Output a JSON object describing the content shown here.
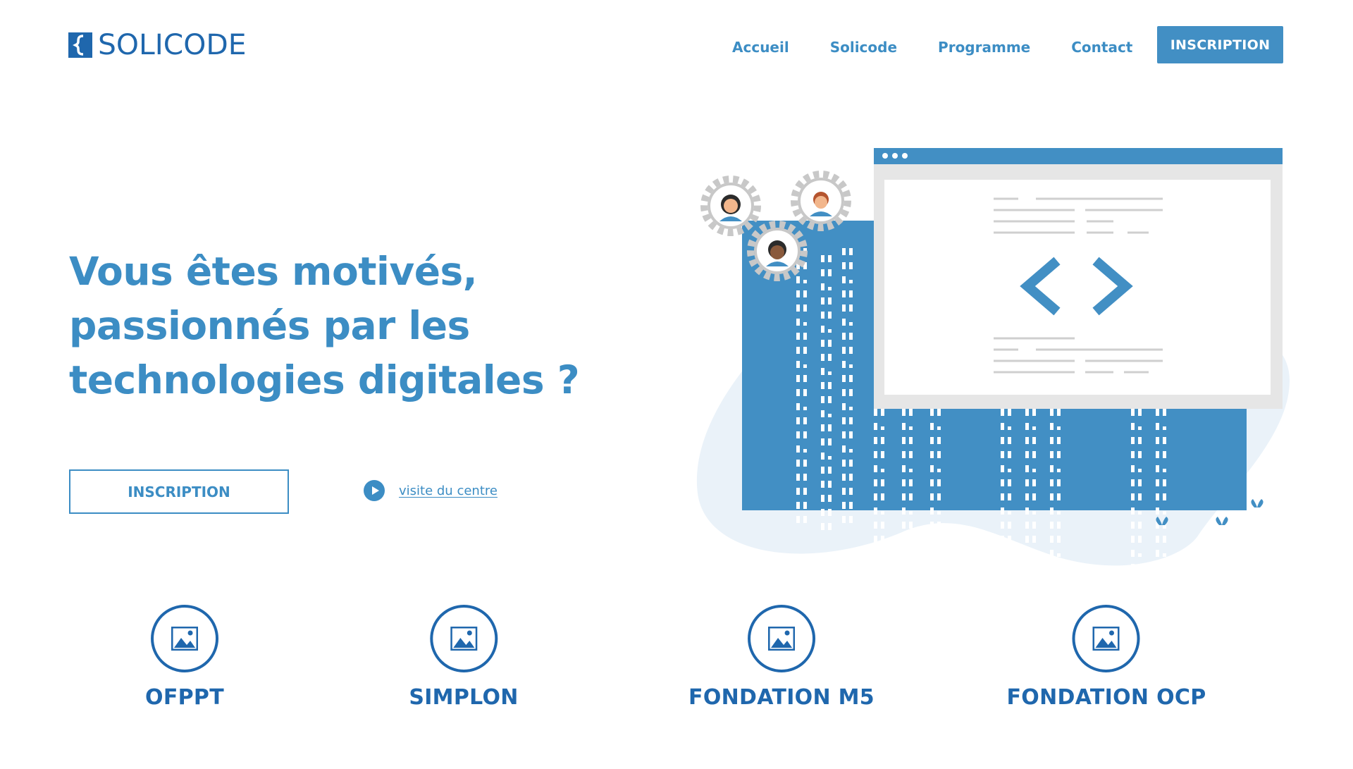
{
  "header": {
    "logo_text": "SOLICODE",
    "nav": [
      {
        "label": "Accueil"
      },
      {
        "label": "Solicode"
      },
      {
        "label": "Programme"
      },
      {
        "label": "Contact"
      }
    ],
    "cta_label": "INSCRIPTION"
  },
  "hero": {
    "title_lines": [
      "Vous êtes motivés,",
      "passionnés par les",
      "technologies digitales ?"
    ],
    "cta_label": "INSCRIPTION",
    "visit_label": "visite du centre"
  },
  "partners": [
    {
      "name": "OFPPT",
      "icon": "image-icon"
    },
    {
      "name": "SIMPLON",
      "icon": "image-icon"
    },
    {
      "name": "FONDATION M5",
      "icon": "image-icon"
    },
    {
      "name": "FONDATION OCP",
      "icon": "image-icon"
    }
  ],
  "colors": {
    "primary": "#3c8dc4",
    "dark_blue": "#1f67ad",
    "panel_blue": "#428fc4",
    "blob": "#eaf2f9"
  }
}
